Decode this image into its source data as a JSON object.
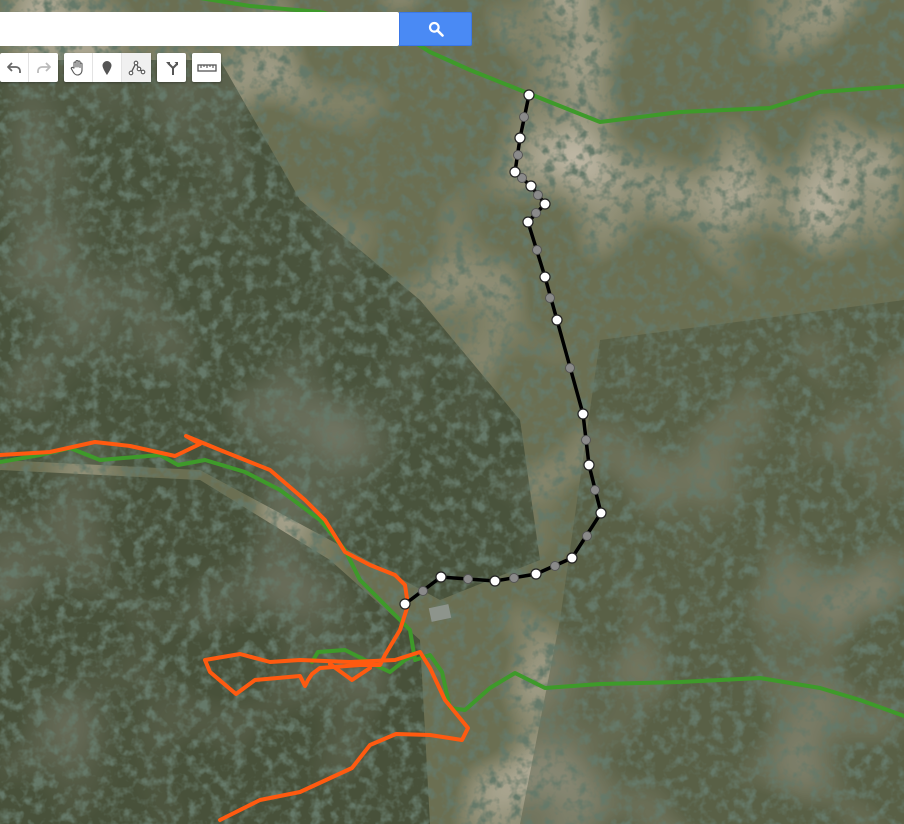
{
  "search": {
    "value": "",
    "placeholder": ""
  },
  "icons": {
    "search": "magnifier-icon",
    "undo": "undo-arrow-icon",
    "redo": "redo-arrow-icon",
    "pan": "hand-icon",
    "marker": "map-pin-icon",
    "draw_line": "draw-line-icon",
    "directions": "route-icon",
    "measure": "ruler-icon"
  },
  "colors": {
    "search_button": "#4a8af4",
    "green_trail": "#3e9a2a",
    "orange_trail": "#ff5a10",
    "drawn_line": "#000000",
    "vertex": "#ffffff",
    "midpoint": "#8a8a8a"
  }
}
